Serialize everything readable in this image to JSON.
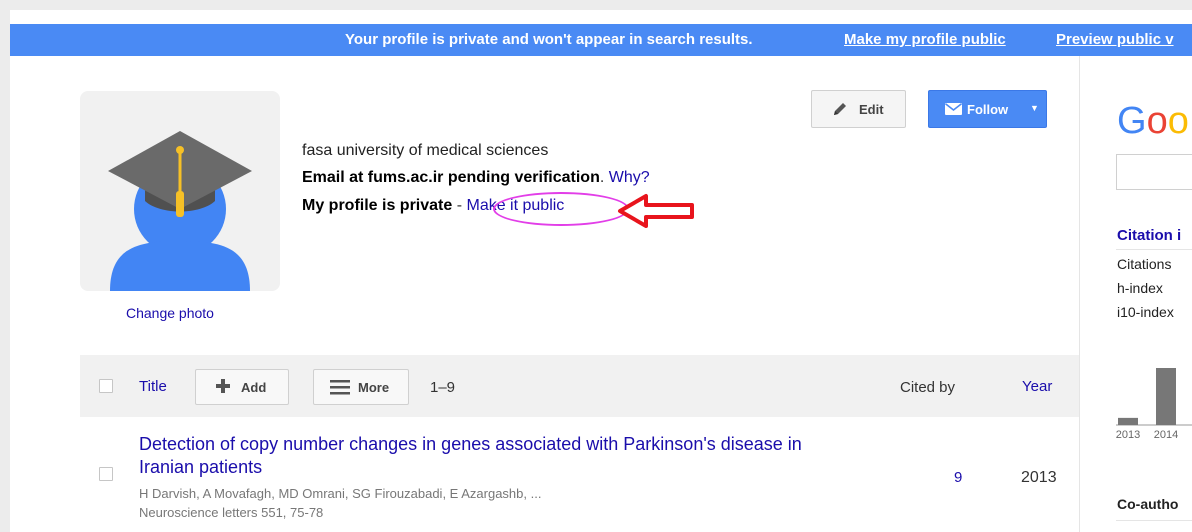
{
  "banner": {
    "message": "Your profile is private and won't appear in search results.",
    "make_public_link": "Make my profile public",
    "preview_link": "Preview public v",
    "bg_color": "#4a8af4"
  },
  "profile": {
    "change_photo": "Change photo",
    "affiliation": "fasa university of medical sciences",
    "email_status": "Email at fums.ac.ir pending verification",
    "email_period": ".",
    "why_link": "Why?",
    "private_status": "My profile is private",
    "dash": " - ",
    "make_public_link": "Make it public"
  },
  "actions": {
    "edit_label": "Edit",
    "edit_icon": "pencil-icon",
    "follow_label": "Follow",
    "follow_icon": "envelope-icon",
    "follow_caret": "▼"
  },
  "table": {
    "title_col": "Title",
    "add_label": "Add",
    "more_label": "More",
    "range": "1–9",
    "cited_by_col": "Cited by",
    "year_col": "Year"
  },
  "articles": [
    {
      "title": "Detection of copy number changes in genes associated with Parkinson's disease in Iranian patients",
      "authors": "H Darvish, A Movafagh, MD Omrani, SG Firouzabadi, E Azargashb, ...",
      "venue": "Neuroscience letters 551, 75-78",
      "cited_by": "9",
      "year": "2013"
    }
  ],
  "right_panel": {
    "logo_text": "Goo",
    "citation_heading": "Citation i",
    "stats": [
      "Citations",
      "h-index",
      "i10-index"
    ],
    "chart_years": [
      "2013",
      "2014"
    ],
    "coauthors_heading": "Co-autho"
  },
  "chart_data": {
    "type": "bar",
    "categories": [
      "2013",
      "2014"
    ],
    "values": [
      1,
      8
    ],
    "title": "",
    "xlabel": "",
    "ylabel": "",
    "ylim": [
      0,
      8
    ]
  },
  "colors": {
    "link": "#1a0dab",
    "accent": "#4a8af4",
    "annotation_arrow": "#e8141c",
    "annotation_ellipse": "#e23ee8",
    "google_blue": "#4285f4",
    "google_red": "#ea4335",
    "google_yellow": "#fbbc05"
  }
}
